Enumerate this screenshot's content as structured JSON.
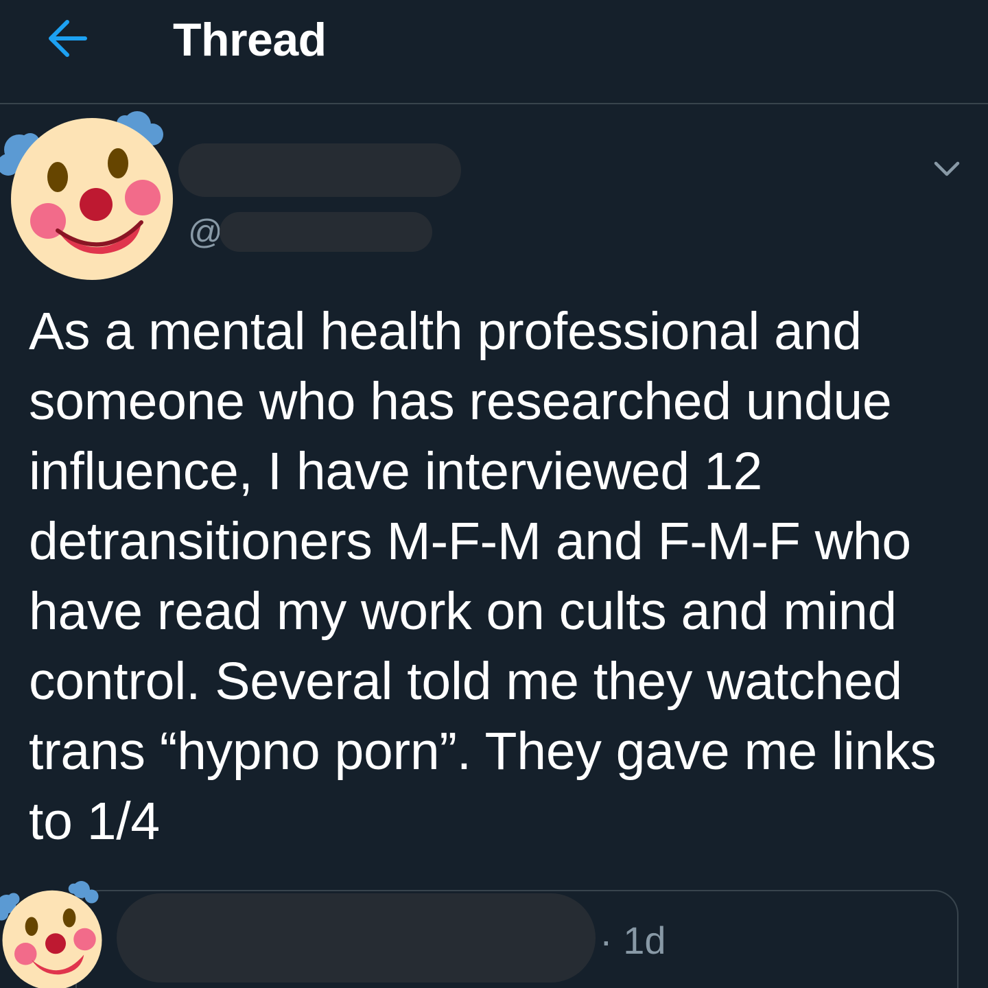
{
  "header": {
    "title": "Thread",
    "back_icon": "arrow-left-icon",
    "accent_color": "#1da1f2"
  },
  "tweet": {
    "handle_prefix": "@",
    "text": "As a mental health professional and someone who has researched undue influence, I have interviewed 12 detransitioners M-F-M and F-M-F who have read my work on cults and mind control. Several told me they watched trans “hypno porn”. They gave me links to 1/4",
    "avatar_icon": "clown-face-icon",
    "menu_icon": "chevron-down-icon"
  },
  "reply": {
    "timestamp": "· 1d",
    "avatar_icon": "clown-face-icon"
  }
}
